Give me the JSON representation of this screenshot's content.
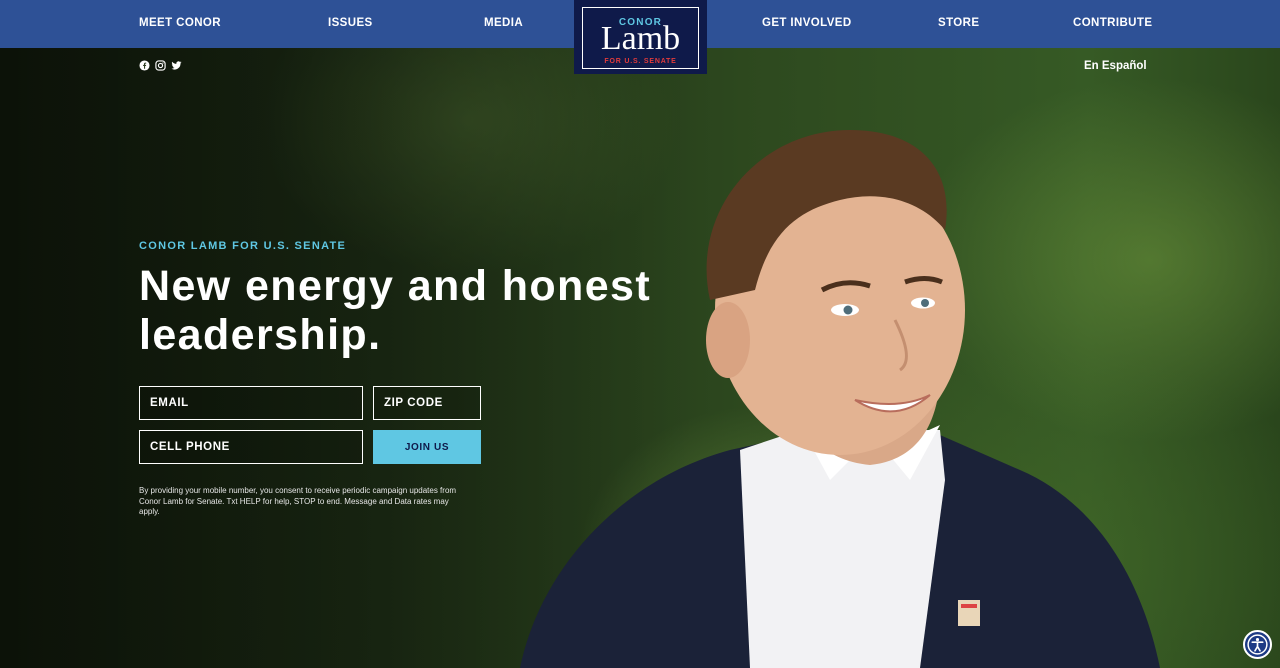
{
  "nav": {
    "left": [
      "MEET CONOR",
      "ISSUES",
      "MEDIA"
    ],
    "right": [
      "GET INVOLVED",
      "STORE",
      "CONTRIBUTE"
    ]
  },
  "logo": {
    "top": "CONOR",
    "name": "Lamb",
    "sub": "FOR U.S. SENATE"
  },
  "social": [
    "facebook-icon",
    "instagram-icon",
    "twitter-icon"
  ],
  "language_link": "En Español",
  "hero": {
    "eyebrow": "CONOR LAMB FOR U.S. SENATE",
    "headline": "New energy and honest leadership."
  },
  "form": {
    "email_placeholder": "EMAIL",
    "zip_placeholder": "ZIP CODE",
    "phone_placeholder": "CELL PHONE",
    "submit_label": "JOIN US",
    "disclaimer": "By providing your mobile number, you consent to receive periodic campaign updates from Conor Lamb for Senate. Txt HELP for help, STOP to end. Message and Data rates may apply."
  },
  "colors": {
    "nav_bg": "#2e5196",
    "logo_bg": "#0f1a4a",
    "accent": "#5fc7e3",
    "logo_red": "#e13b3b"
  },
  "accessibility_icon": "accessibility-icon"
}
